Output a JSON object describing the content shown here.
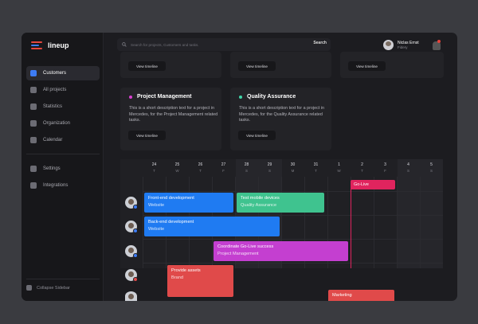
{
  "app": {
    "name": "lineup"
  },
  "colors": {
    "accent": "#3d7cf5",
    "today": "#e0245e"
  },
  "sidebar": {
    "items": [
      {
        "label": "Customers",
        "icon": "customers-icon",
        "active": true
      },
      {
        "label": "All projects",
        "icon": "grid-icon"
      },
      {
        "label": "Statistics",
        "icon": "chart-icon"
      },
      {
        "label": "Organization",
        "icon": "building-icon"
      },
      {
        "label": "Calendar",
        "icon": "calendar-icon"
      }
    ],
    "secondary": [
      {
        "label": "Settings",
        "icon": "gear-icon"
      },
      {
        "label": "Integrations",
        "icon": "plug-icon"
      }
    ],
    "collapse_label": "Collapse Sidebar"
  },
  "header": {
    "search_placeholder": "Search for projects, Customers and tasks.",
    "search_button": "Search",
    "user_name": "Niclas Ernst",
    "user_role": "Fidery"
  },
  "cards": {
    "view_timeline": "View timeline",
    "projects": [
      {
        "title": "Project Management",
        "color": "#d93fd0",
        "desc": "This is a short description text for a project in Mercedes, for the Project Management related tasks."
      },
      {
        "title": "Quality Assurance",
        "color": "#3fd6a8",
        "desc": "This is a short description text for a project in Mercedes, for the Quality Assurance related tasks."
      }
    ]
  },
  "timeline": {
    "days": [
      {
        "d": "24",
        "w": "T"
      },
      {
        "d": "25",
        "w": "W"
      },
      {
        "d": "26",
        "w": "T"
      },
      {
        "d": "27",
        "w": "F"
      },
      {
        "d": "28",
        "w": "S"
      },
      {
        "d": "29",
        "w": "S"
      },
      {
        "d": "30",
        "w": "M"
      },
      {
        "d": "31",
        "w": "T"
      },
      {
        "d": "1",
        "w": "W"
      },
      {
        "d": "2",
        "w": "T"
      },
      {
        "d": "3",
        "w": "F"
      },
      {
        "d": "4",
        "w": "S"
      },
      {
        "d": "5",
        "w": "S"
      }
    ],
    "milestone": "Go-Live",
    "tasks": [
      {
        "title": "Front-end development",
        "sub": "Website",
        "color": "#1f7bf2"
      },
      {
        "title": "Test mobile devices",
        "sub": "Quality Assurance",
        "color": "#3fc38f"
      },
      {
        "title": "Back-end development",
        "sub": "Website",
        "color": "#1f7bf2"
      },
      {
        "title": "Coordinate Go-Live success",
        "sub": "Project Management",
        "color": "#c43fd0"
      },
      {
        "title": "Provide assets",
        "sub": "Brand",
        "color": "#e04a4a"
      },
      {
        "title": "Marketing",
        "sub": "",
        "color": "#e04a4a"
      }
    ]
  }
}
